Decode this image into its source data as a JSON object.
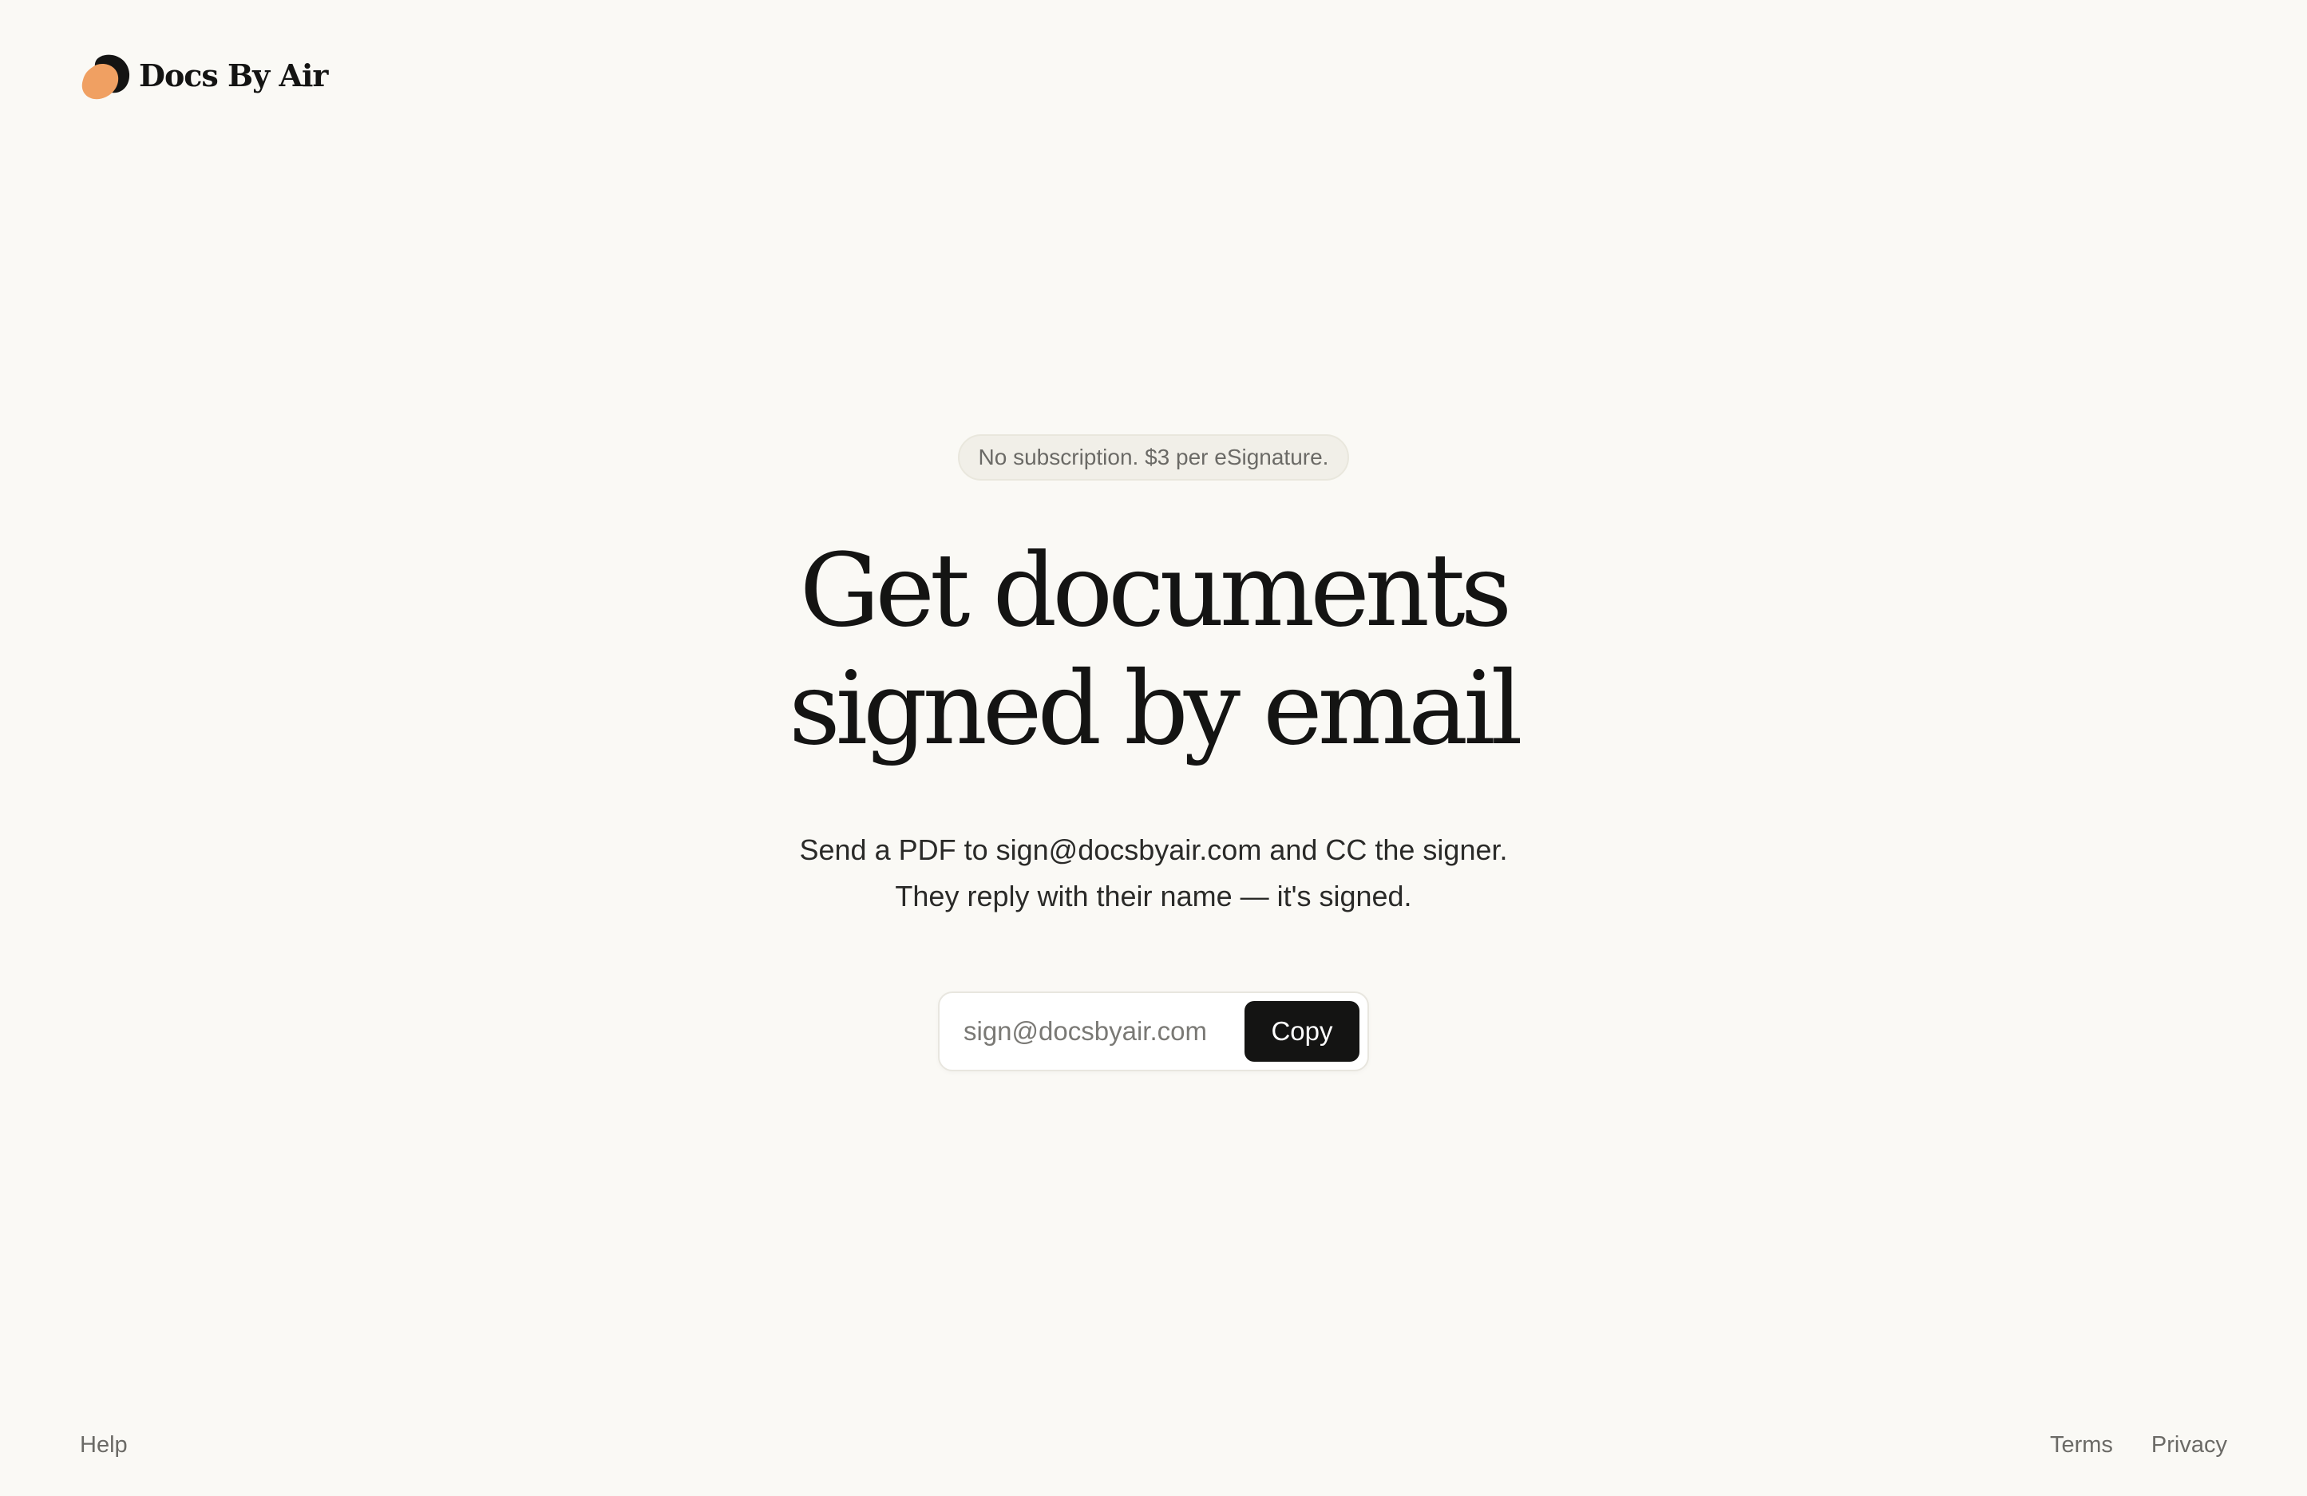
{
  "brand": {
    "name": "Docs By Air",
    "logo_icon": "brand-blob-icon",
    "logo_colors": [
      "#141413",
      "#f0a062"
    ]
  },
  "hero": {
    "badge": "No subscription. $3 per eSignature.",
    "headline_line1": "Get documents",
    "headline_line2": "signed by email",
    "subtext_line1": "Send a PDF to sign@docsbyair.com and CC the signer.",
    "subtext_line2": "They reply with their name — it's signed."
  },
  "copy_box": {
    "value": "sign@docsbyair.com",
    "button_label": "Copy"
  },
  "footer": {
    "help": "Help",
    "terms": "Terms",
    "privacy": "Privacy"
  },
  "colors": {
    "background": "#faf9f5",
    "text": "#141413",
    "accent": "#f0a062",
    "button": "#141413"
  }
}
